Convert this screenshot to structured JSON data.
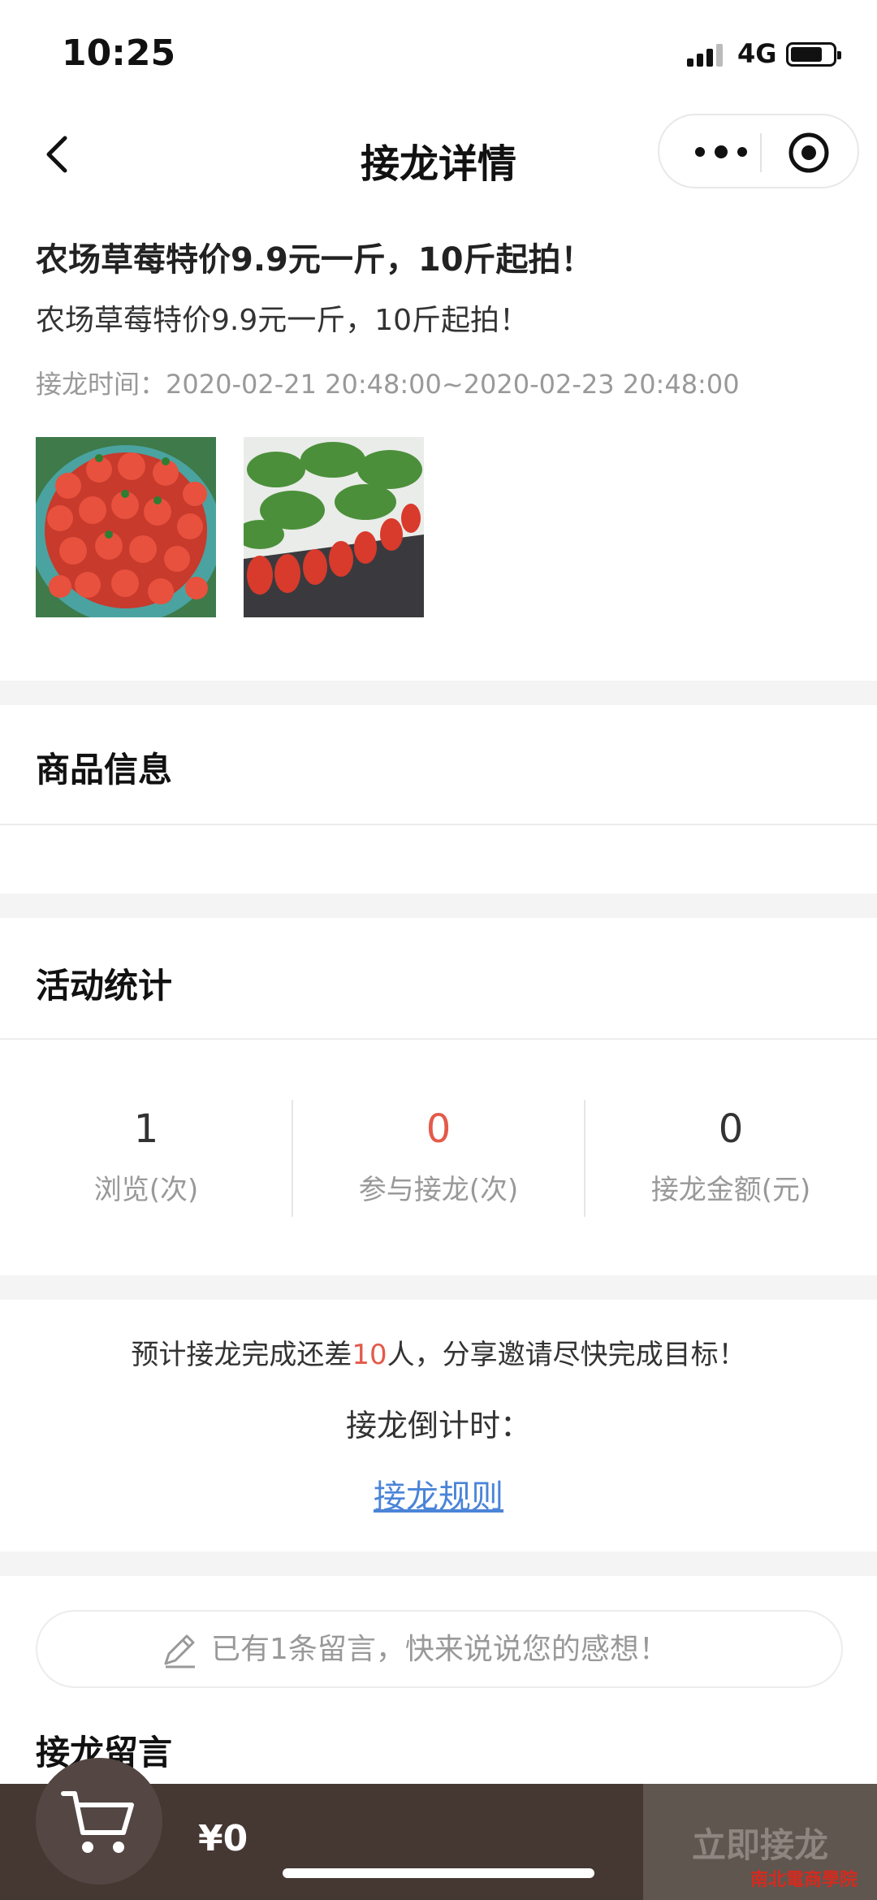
{
  "status_bar": {
    "time": "10:25",
    "network": "4G"
  },
  "nav": {
    "title": "接龙详情"
  },
  "post": {
    "title": "农场草莓特价9.9元一斤，10斤起拍！",
    "description": "农场草莓特价9.9元一斤，10斤起拍！",
    "time_label": "接龙时间：",
    "time_range": "2020-02-21 20:48:00~2020-02-23 20:48:00"
  },
  "sections": {
    "product_info": "商品信息",
    "activity_stats": "活动统计",
    "comments": "接龙留言"
  },
  "stats": [
    {
      "value": "1",
      "label": "浏览(次)"
    },
    {
      "value": "0",
      "label": "参与接龙(次)"
    },
    {
      "value": "0",
      "label": "接龙金额(元)"
    }
  ],
  "goal": {
    "prefix": "预计接龙完成还差",
    "count": "10",
    "suffix": "人，分享邀请尽快完成目标！"
  },
  "countdown_label": "接龙倒计时：",
  "rules_link": "接龙规则",
  "comment_prompt": "已有1条留言，快来说说您的感想！",
  "bottom": {
    "price": "¥0",
    "join_button": "立即接龙"
  },
  "watermark": "南北電商學院",
  "colors": {
    "accent_red": "#e35a4a",
    "link_blue": "#4a84d8",
    "bottom_bar": "#453833"
  }
}
